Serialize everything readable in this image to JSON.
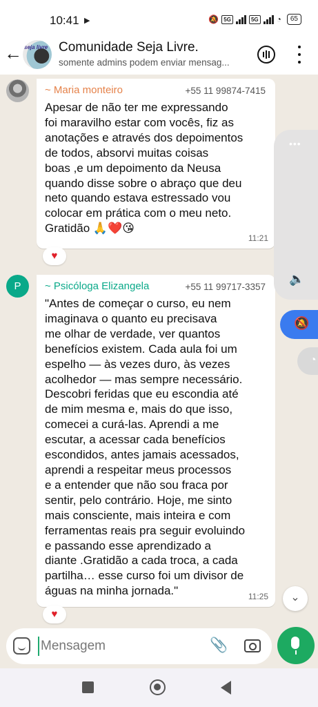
{
  "status_bar": {
    "time": "10:41",
    "network_badge_1": "5G",
    "network_badge_2": "5G",
    "battery": "65"
  },
  "chat_header": {
    "group_name": "Comunidade Seja Livre.",
    "subtitle": "somente admins podem enviar mensag...",
    "avatar_text": "seja livre"
  },
  "messages": [
    {
      "sender": "~ Maria monteiro",
      "sender_color": "#e5824a",
      "phone": "+55 11 99874-7415",
      "text": "Apesar de não ter me expressando\nfoi maravilho estar com vocês, fiz as\nanotações e através dos depoimentos\nde todos, absorvi muitas coisas\nboas ,e um depoimento da Neusa\nquando disse sobre o abraço que deu\nneto quando estava estressado vou\ncolocar em prática com o meu neto.\nGratidão 🙏❤️😘",
      "time": "11:21",
      "reaction": "♥"
    },
    {
      "sender": "~ Psicóloga Elizangela",
      "sender_color": "#0aa989",
      "avatar_letter": "P",
      "phone": "+55 11 99717-3357",
      "text": "\"Antes de começar o curso, eu nem\nimaginava o quanto eu precisava\nme olhar de verdade, ver quantos\nbenefícios existem. Cada aula foi um\nespelho — às vezes duro, às vezes\nacolhedor — mas sempre necessário.\nDescobri feridas que eu escondia até\nde mim mesma e, mais do que isso,\ncomecei a curá-las. Aprendi a me\nescutar, a acessar cada benefícios\nescondidos, antes jamais acessados,\naprendi a respeitar meus processos\ne a entender que não sou fraca por\nsentir, pelo contrário. Hoje, me sinto\nmais consciente, mais inteira e com\nferramentas reais pra seguir evoluindo\ne passando esse aprendizado a\ndiante .Gratidão a cada troca, a cada\npartilha… esse curso foi um divisor de\náguas na minha jornada.\"",
      "time": "11:25",
      "reaction": "♥"
    }
  ],
  "composer": {
    "placeholder": "Mensagem"
  },
  "colors": {
    "accent_green": "#1daa61",
    "mute_blue": "#3a7bef"
  }
}
